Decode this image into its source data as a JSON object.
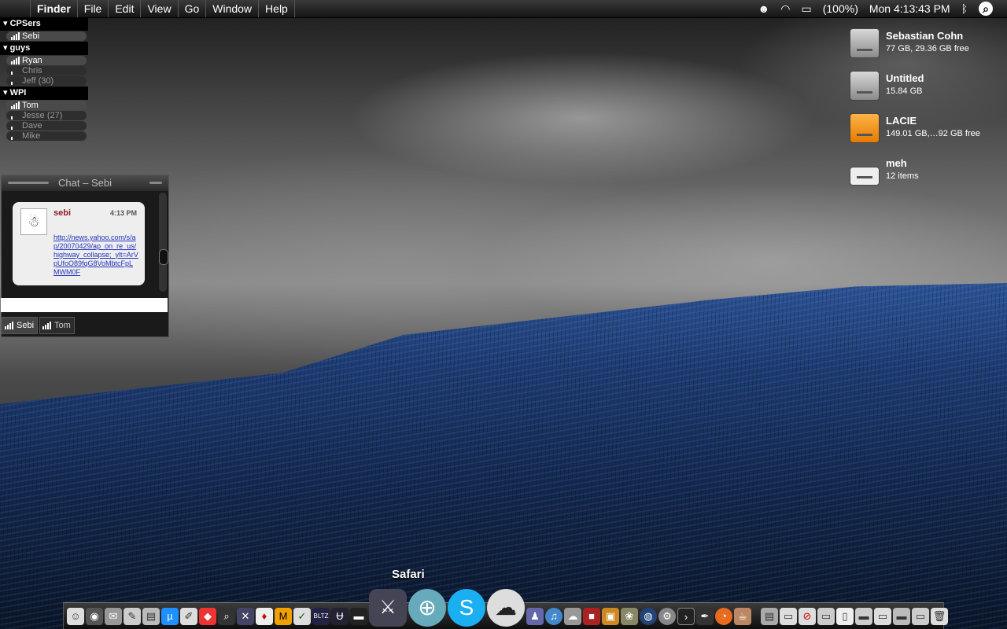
{
  "menubar": {
    "app": "Finder",
    "menus": [
      "File",
      "Edit",
      "View",
      "Go",
      "Window",
      "Help"
    ],
    "battery": "(100%)",
    "clock": "Mon 4:13:43 PM"
  },
  "buddy_list": {
    "groups": [
      {
        "name": "CPSers",
        "buddies": [
          {
            "name": "Sebi",
            "status": "online"
          }
        ]
      },
      {
        "name": "guys",
        "buddies": [
          {
            "name": "Ryan",
            "status": "online"
          },
          {
            "name": "Chris",
            "status": "idle"
          },
          {
            "name": "Jeff",
            "idle": "(30)",
            "status": "idle"
          }
        ]
      },
      {
        "name": "WPI",
        "buddies": [
          {
            "name": "Tom",
            "status": "online"
          },
          {
            "name": "Jesse",
            "idle": "(27)",
            "status": "idle"
          },
          {
            "name": "Dave",
            "status": "idle"
          },
          {
            "name": "Mike",
            "status": "idle"
          }
        ]
      }
    ]
  },
  "chat": {
    "title": "Chat – Sebi",
    "message": {
      "sender": "sebi",
      "time": "4:13 PM",
      "link": "http://news.yahoo.com/s/ap/20070429/ap_on_re_us/highway_collapse;_ylt=ArVpUfoO89fqG8VoMbtcFpLMWM0F"
    },
    "tabs": [
      "Sebi",
      "Tom"
    ]
  },
  "drives": [
    {
      "name": "Sebastian Cohn",
      "info": "77 GB, 29.36 GB free",
      "icon": "hard-drive-icon"
    },
    {
      "name": "Untitled",
      "info": "15.84 GB",
      "icon": "hard-drive-icon"
    },
    {
      "name": "LACIE",
      "info": "149.01 GB,…92 GB free",
      "icon": "usb-drive-icon"
    },
    {
      "name": "meh",
      "info": "12 items",
      "icon": "disk-image-icon"
    }
  ],
  "dock": {
    "hover_label": "Safari"
  }
}
